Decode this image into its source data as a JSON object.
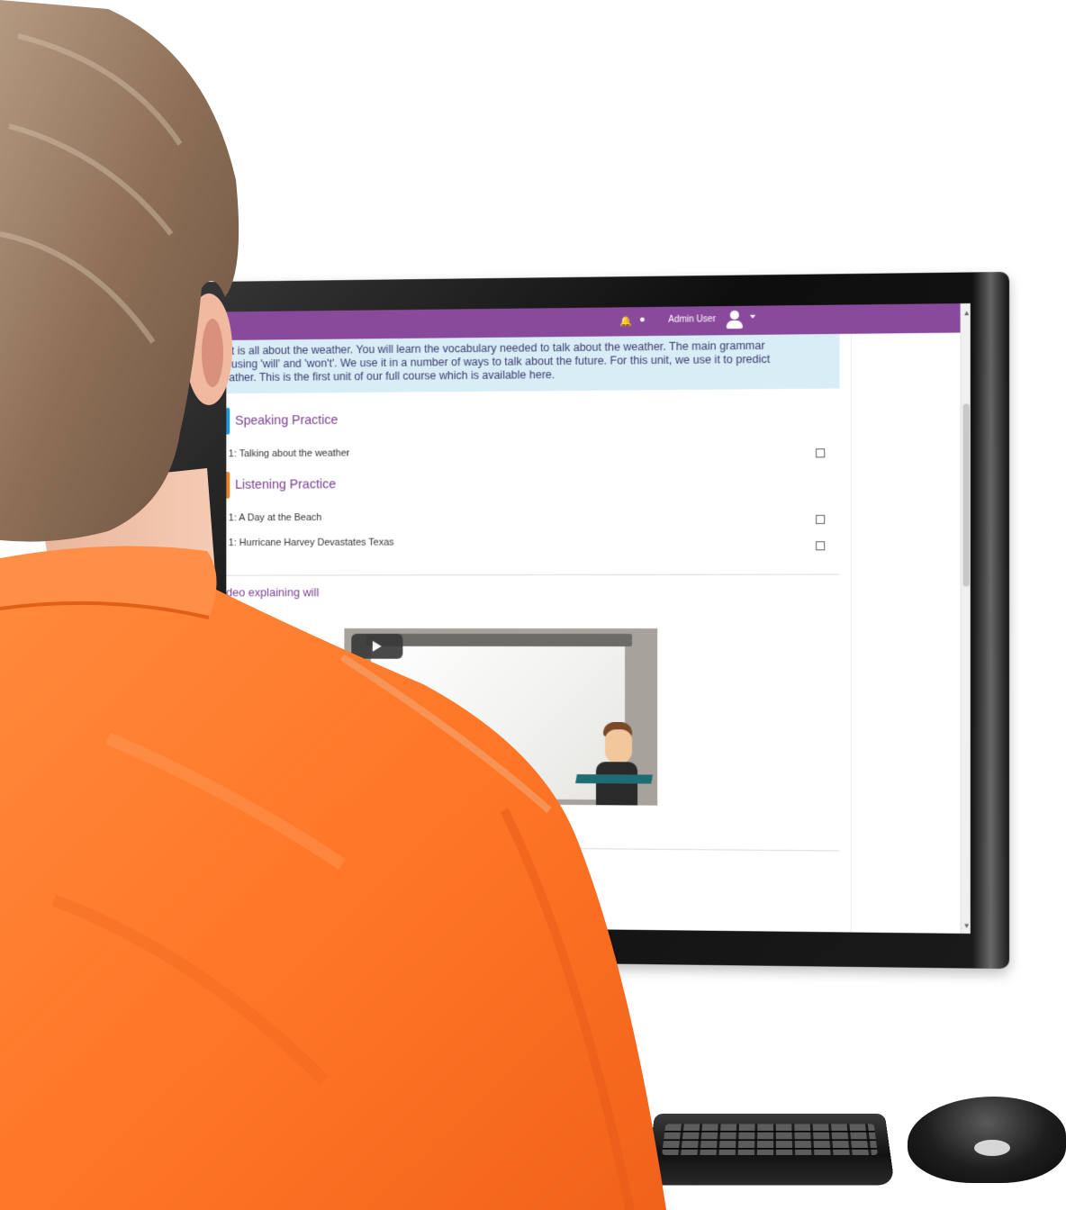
{
  "topbar": {
    "user_name": "Admin User"
  },
  "summary": {
    "line1": "nit is all about the weather. You will learn the vocabulary needed to talk about the weather. The main grammar",
    "line2": "s using 'will' and 'won't'. We use it in a number of ways to talk about the future. For this unit, we use it to predict",
    "line3": "eather. This is the first unit of our full course which is available here."
  },
  "sections": {
    "speaking": {
      "title": "Speaking Practice",
      "items": [
        {
          "label": "Unit 1: Talking about the weather"
        }
      ]
    },
    "listening": {
      "title": "Listening Practice",
      "items": [
        {
          "label": "Unit 1: A Day at the Beach"
        },
        {
          "label": "Unit 1: Hurricane Harvey Devastates Texas"
        }
      ]
    }
  },
  "video": {
    "title": "1: Video explaining will"
  },
  "colors": {
    "topbar": "#8a4a9c",
    "summary_bg": "#d9edf7",
    "section_title": "#7a3e91",
    "speaking_icon": "#1e9bd7",
    "listening_icon": "#e8832a",
    "shirt": "#ff7a2e"
  },
  "icons": {
    "bell": "bell-icon",
    "chat": "chat-icon",
    "avatar": "user-avatar-icon",
    "speaking": "speech-bubble-icon",
    "listening": "person-icon",
    "forum": "forum-icon",
    "quiz": "checklist-icon",
    "play": "play-icon"
  }
}
